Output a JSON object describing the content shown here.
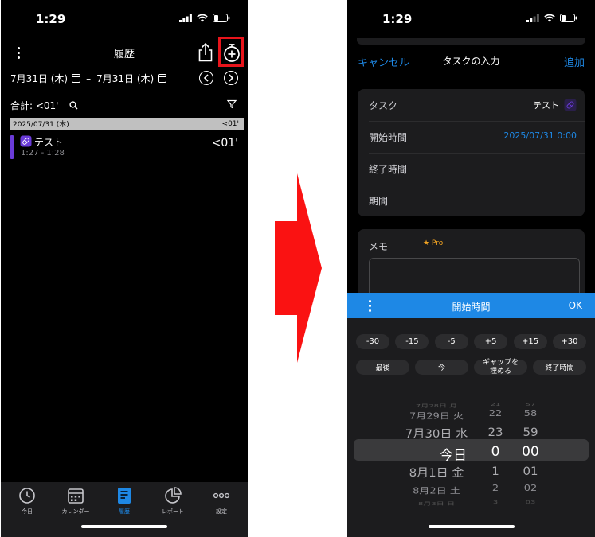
{
  "left": {
    "status_time": "1:29",
    "nav": {
      "title": "履歴"
    },
    "date_range": {
      "from": "7月31日 (木)",
      "separator": "–",
      "to": "7月31日 (木)"
    },
    "total": {
      "label": "合計: <01'"
    },
    "day": {
      "date": "2025/07/31 (木)",
      "total": "<01'"
    },
    "entries": [
      {
        "name": "テスト",
        "time": "1:27 - 1:28",
        "duration": "<01'",
        "color": "#6a3bd8"
      }
    ],
    "tabs": [
      {
        "label": "今日",
        "icon": "clock-icon"
      },
      {
        "label": "カレンダー",
        "icon": "calendar-icon"
      },
      {
        "label": "履歴",
        "icon": "history-icon",
        "active": true
      },
      {
        "label": "レポート",
        "icon": "pie-chart-icon"
      },
      {
        "label": "設定",
        "icon": "more-dots-icon"
      }
    ]
  },
  "right": {
    "status_time": "1:29",
    "nav": {
      "cancel": "キャンセル",
      "title": "タスクの入力",
      "add": "追加"
    },
    "form": {
      "task_label": "タスク",
      "task_value": "テスト",
      "start_label": "開始時間",
      "start_value": "2025/07/31 0:00",
      "end_label": "終了時間",
      "period_label": "期間"
    },
    "memo": {
      "label": "メモ",
      "pro_badge": "★ Pro"
    },
    "picker": {
      "title": "開始時間",
      "ok": "OK",
      "offsets": [
        "-30",
        "-15",
        "-5",
        "+5",
        "+15",
        "+30"
      ],
      "actions": [
        "最後",
        "今",
        "ギャップを 埋める",
        "終了時間"
      ],
      "wheel": [
        {
          "date": "7月28日 月",
          "hour": "21",
          "minute": "57"
        },
        {
          "date": "7月29日 火",
          "hour": "22",
          "minute": "58"
        },
        {
          "date": "7月30日 水",
          "hour": "23",
          "minute": "59"
        },
        {
          "date": "今日",
          "hour": "0",
          "minute": "00"
        },
        {
          "date": "8月1日 金",
          "hour": "1",
          "minute": "01"
        },
        {
          "date": "8月2日 土",
          "hour": "2",
          "minute": "02"
        },
        {
          "date": "8月3日 日",
          "hour": "3",
          "minute": "03"
        }
      ]
    }
  },
  "colors": {
    "accent": "#1e88e5",
    "highlight_red": "#e8141b",
    "task_purple": "#6a3bd8",
    "pro_orange": "#f5a623"
  }
}
